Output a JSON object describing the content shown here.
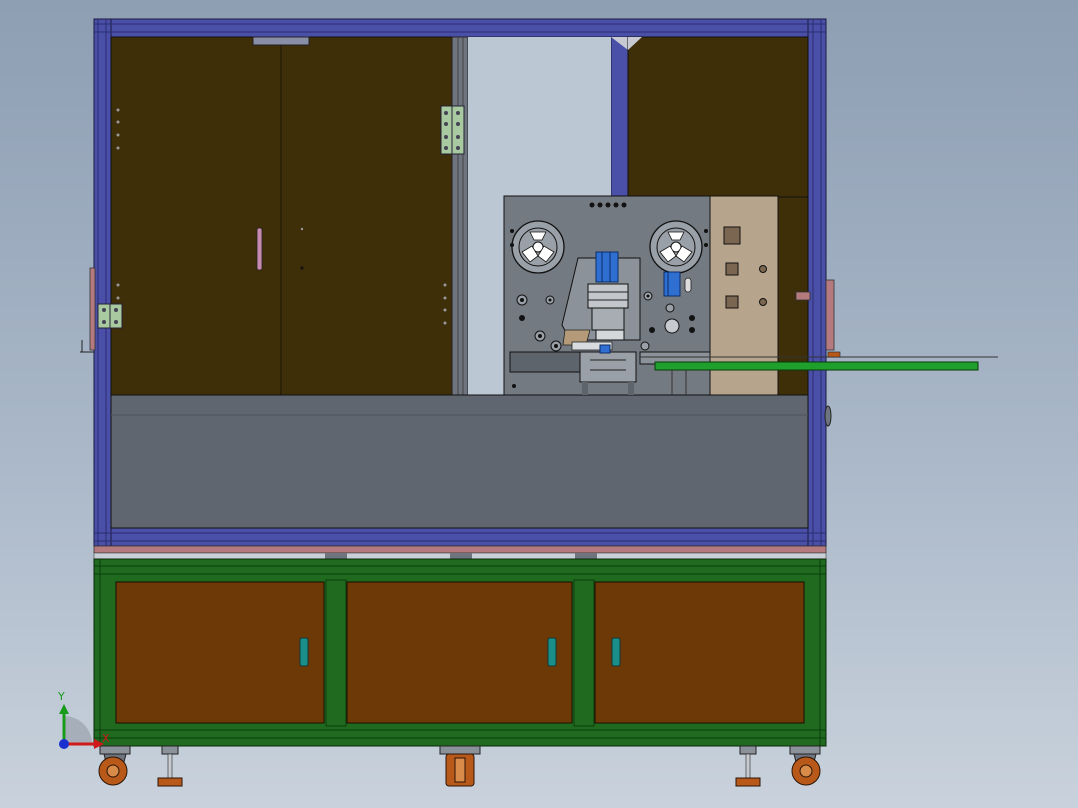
{
  "triad": {
    "y_label": "Y",
    "x_label": "X"
  },
  "colors": {
    "frame": "#4a4fa8",
    "door_left": "#3e2f08",
    "door_right": "#3e2f08",
    "panel_grey": "#5f666f",
    "machine_plate": "#747a82",
    "control_box": "#b7a48c",
    "conveyor": "#1fa02c",
    "cabinet_frame": "#1f6a1f",
    "cabinet_door": "#6d3a07",
    "handle": "#1a8f8a",
    "hinge": "#a9c9a0",
    "top_rail": "#b57a7e",
    "caster": "#b8591a"
  }
}
